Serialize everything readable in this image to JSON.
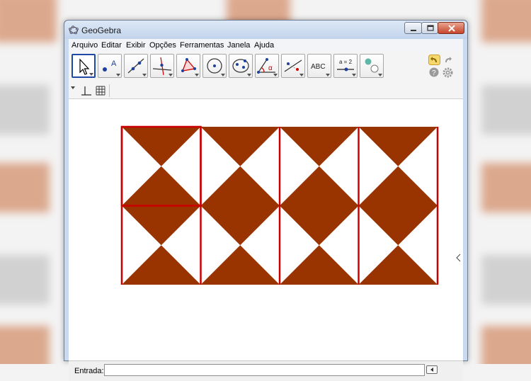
{
  "window": {
    "title": "GeoGebra",
    "icon": "geogebra-logo-icon",
    "controls": [
      "minimize-icon",
      "maximize-icon",
      "close-icon"
    ]
  },
  "menu": {
    "items": [
      "Arquivo",
      "Editar",
      "Exibir",
      "Opções",
      "Ferramentas",
      "Janela",
      "Ajuda"
    ]
  },
  "toolbar": {
    "tools": [
      {
        "name": "move-tool-icon",
        "selected": true
      },
      {
        "name": "point-tool-icon",
        "label": "A"
      },
      {
        "name": "line-tool-icon"
      },
      {
        "name": "perpendicular-line-tool-icon"
      },
      {
        "name": "polygon-tool-icon"
      },
      {
        "name": "circle-tool-icon"
      },
      {
        "name": "ellipse-tool-icon"
      },
      {
        "name": "angle-tool-icon",
        "label": "α"
      },
      {
        "name": "reflect-tool-icon"
      },
      {
        "name": "text-tool-icon",
        "label": "ABC"
      },
      {
        "name": "slider-tool-icon",
        "label": "a = 2"
      },
      {
        "name": "show-hide-tool-icon"
      }
    ],
    "right": [
      "undo-icon",
      "redo-icon",
      "help-icon",
      "settings-gear-icon"
    ]
  },
  "stylebar": [
    "stylebar-toggle-icon",
    "axes-toggle-icon",
    "grid-toggle-icon"
  ],
  "graphics": {
    "figure": "tiled triangles pattern",
    "fill_color": "#993300",
    "line_color": "#cc0000",
    "columns": 4,
    "rows": 2,
    "highlighted_cell": {
      "column": 1,
      "row": 1
    }
  },
  "input_bar": {
    "label": "Entrada:",
    "value": "",
    "keyboard_button_icon": "input-help-icon"
  }
}
